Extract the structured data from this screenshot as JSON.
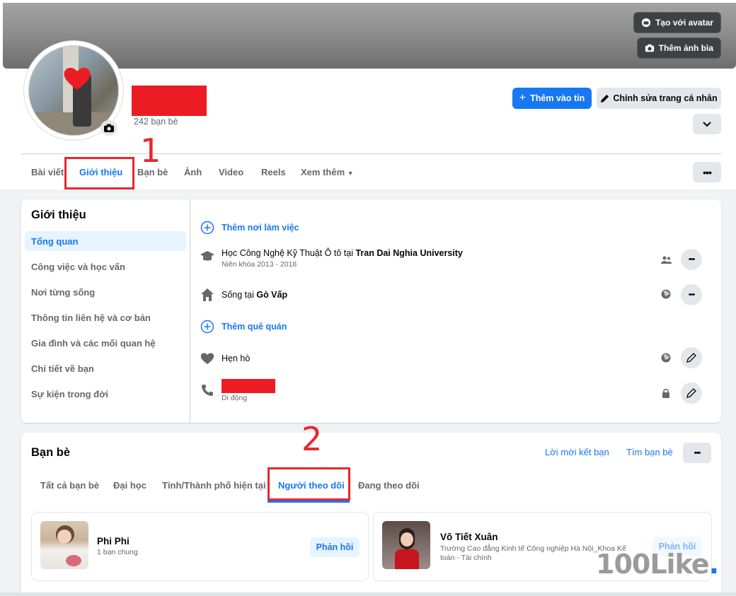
{
  "cover": {
    "avatar_button": "Tạo với avatar",
    "cover_button": "Thêm ảnh bìa"
  },
  "profile": {
    "friend_count": "242 bạn bè",
    "add_story": "Thêm vào tin",
    "edit_profile": "Chỉnh sửa trang cá nhân"
  },
  "tabs": [
    {
      "label": "Bài viết"
    },
    {
      "label": "Giới thiệu",
      "active": true
    },
    {
      "label": "Bạn bè"
    },
    {
      "label": "Ảnh"
    },
    {
      "label": "Video"
    },
    {
      "label": "Reels"
    },
    {
      "label": "Xem thêm"
    }
  ],
  "annotations": {
    "step1": "1",
    "step2": "2"
  },
  "about": {
    "title": "Giới thiệu",
    "nav": [
      {
        "label": "Tổng quan",
        "active": true
      },
      {
        "label": "Công việc và học vấn"
      },
      {
        "label": "Nơi từng sống"
      },
      {
        "label": "Thông tin liên hệ và cơ bản"
      },
      {
        "label": "Gia đình và các mối quan hệ"
      },
      {
        "label": "Chi tiết về bạn"
      },
      {
        "label": "Sự kiện trong đời"
      }
    ],
    "add_workplace": "Thêm nơi làm việc",
    "education_prefix": "Học Công Nghệ Kỹ Thuật Ô tô tại ",
    "education_school": "Tran Dai Nghia University",
    "education_years": "Niên khóa 2013 - 2018",
    "lives_prefix": "Sống tại ",
    "lives_place": "Gò Vấp",
    "add_hometown": "Thêm quê quán",
    "dating": "Hẹn hò",
    "phone_label": "Di động"
  },
  "friends": {
    "title": "Bạn bè",
    "requests_link": "Lời mời kết bạn",
    "find_link": "Tìm bạn bè",
    "tabs": [
      {
        "label": "Tất cả bạn bè"
      },
      {
        "label": "Đại học"
      },
      {
        "label": "Tỉnh/Thành phố hiện tại"
      },
      {
        "label": "Người theo dõi",
        "active": true
      },
      {
        "label": "Đang theo dõi"
      }
    ],
    "cards": [
      {
        "name": "Phi Phi",
        "sub": "1 bạn chung",
        "button": "Phản hồi"
      },
      {
        "name": "Võ Tiết Xuân",
        "sub_line1": "Trường Cao đẳng Kinh tế Công nghiệp Hà Nội_Khoa Kế",
        "sub_line2": "toán - Tài chính",
        "button": "Phản hồi"
      }
    ]
  },
  "watermark": {
    "text": "100Like",
    "dot": "."
  },
  "colors": {
    "accent": "#1877f2",
    "annotation_red": "#e8262f",
    "redaction": "#ec1c24"
  }
}
